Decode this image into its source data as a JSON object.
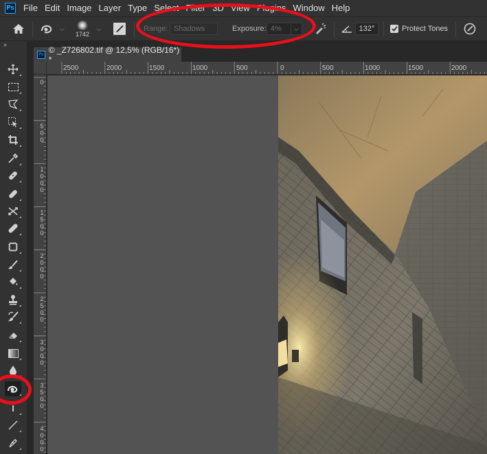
{
  "app": {
    "logo": "Ps"
  },
  "menu": [
    "File",
    "Edit",
    "Image",
    "Layer",
    "Type",
    "Select",
    "Filter",
    "3D",
    "View",
    "Plugins",
    "Window",
    "Help"
  ],
  "options": {
    "brush_size": "1742",
    "range_label": "Range:",
    "range_value": "Shadows",
    "exposure_label": "Exposure:",
    "exposure_value": "4%",
    "angle_value": "132°",
    "protect_tones_label": "Protect Tones",
    "protect_tones_checked": true
  },
  "toolbar": {
    "collapse": "»",
    "tools": [
      "move",
      "marquee",
      "lasso",
      "object-selection",
      "crop",
      "eyedropper",
      "spot-healing",
      "healing",
      "patch",
      "bandage",
      "content-aware",
      "brush",
      "paint-bucket",
      "clone-stamp",
      "history-brush",
      "eraser",
      "gradient",
      "blur",
      "dodge",
      "pen",
      "line",
      "pen-path"
    ],
    "active_tool": "dodge"
  },
  "document": {
    "tab_title": "© _Z726802.tif @ 12,5% (RGB/16*) *",
    "zoom": "12,5%"
  },
  "rulers": {
    "horizontal": [
      "2500",
      "2000",
      "1500",
      "1000",
      "500",
      "0",
      "500",
      "1000",
      "1500",
      "2000"
    ],
    "vertical": [
      "0",
      "500",
      "1000",
      "1500",
      "2000",
      "2500",
      "3000",
      "3500",
      "4000"
    ]
  },
  "colors": {
    "annotation": "#e8101a",
    "panel": "#323232",
    "pasteboard": "#535353"
  }
}
